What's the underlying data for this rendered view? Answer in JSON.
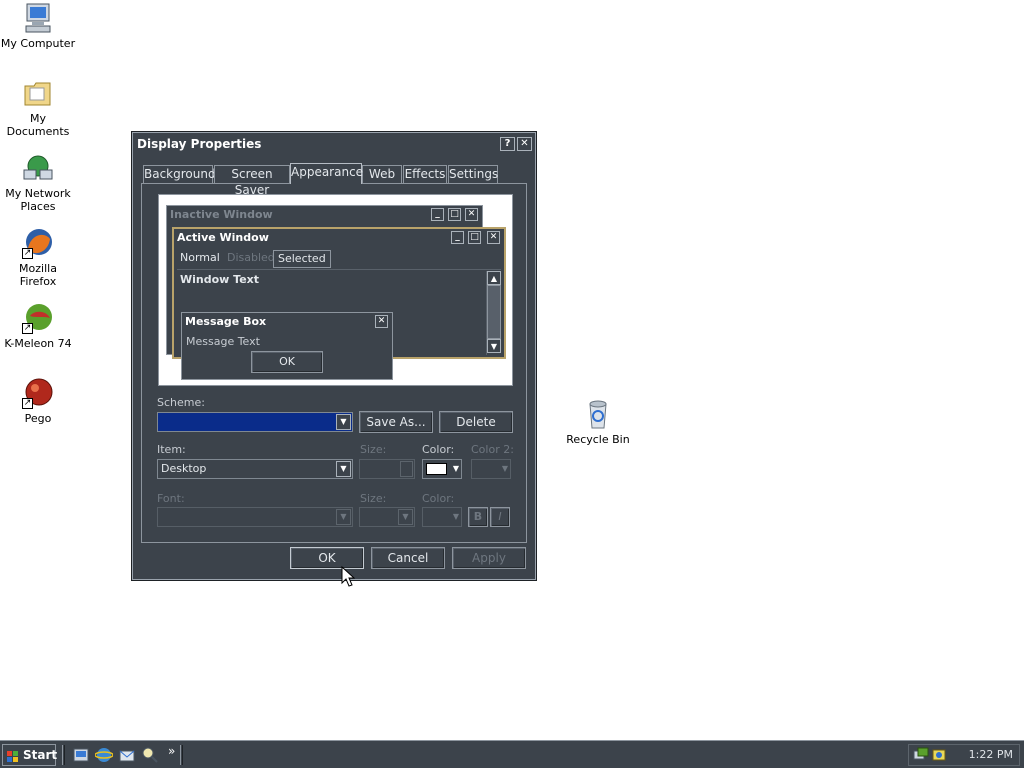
{
  "desktop": {
    "icons": [
      {
        "label": "My Computer"
      },
      {
        "label": "My Documents"
      },
      {
        "label": "My Network Places"
      },
      {
        "label": "Mozilla Firefox"
      },
      {
        "label": "K-Meleon 74"
      },
      {
        "label": "Pego"
      },
      {
        "label": "Recycle Bin"
      }
    ]
  },
  "dialog": {
    "title": "Display Properties",
    "help_button": "?",
    "close_button": "✕",
    "tabs": [
      {
        "label": "Background"
      },
      {
        "label": "Screen Saver"
      },
      {
        "label": "Appearance"
      },
      {
        "label": "Web"
      },
      {
        "label": "Effects"
      },
      {
        "label": "Settings"
      }
    ],
    "active_tab": "Appearance",
    "preview": {
      "inactive_title": "Inactive Window",
      "active_title": "Active Window",
      "menu": [
        "Normal",
        "Disabled",
        "Selected"
      ],
      "window_text": "Window Text",
      "msgbox_title": "Message Box",
      "msgbox_text": "Message Text",
      "msgbox_ok": "OK"
    },
    "scheme": {
      "label": "Scheme:",
      "value": "",
      "save_as": "Save As...",
      "delete": "Delete"
    },
    "item": {
      "label": "Item:",
      "value": "Desktop",
      "size_label": "Size:",
      "color_label": "Color:",
      "color2_label": "Color 2:",
      "color_value": "#ffffff"
    },
    "font": {
      "label": "Font:",
      "size_label": "Size:",
      "color_label": "Color:",
      "bold": "B",
      "italic": "I"
    },
    "buttons": {
      "ok": "OK",
      "cancel": "Cancel",
      "apply": "Apply"
    }
  },
  "taskbar": {
    "start_label": "Start",
    "chevron": "»",
    "clock": "1:22 PM"
  }
}
